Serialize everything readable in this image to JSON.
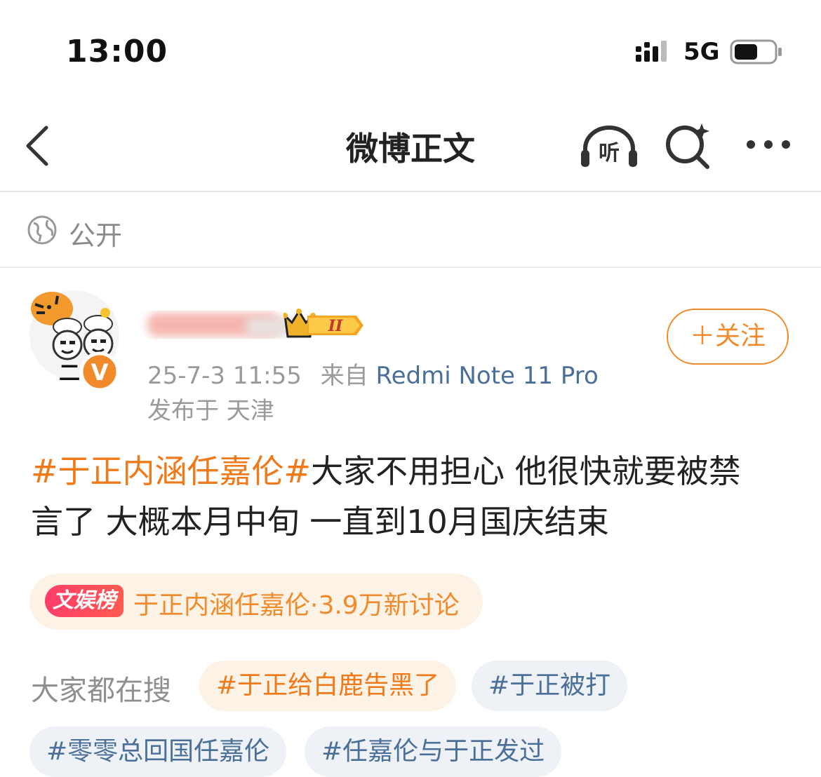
{
  "status_bar": {
    "time": "13:00",
    "network": "5G"
  },
  "nav": {
    "title": "微博正文",
    "listen_label": "听"
  },
  "visibility": {
    "label": "公开"
  },
  "author": {
    "follow_label": "＋关注",
    "verified_mark": "V",
    "avatar_text": "二"
  },
  "meta": {
    "time": "25-7-3 11:55",
    "from_label": "来自",
    "device": "Redmi Note 11 Pro",
    "location": "发布于 天津"
  },
  "post": {
    "hashtag": "#于正内涵任嘉伦#",
    "line1": "大家不用担心 他很快就要被禁",
    "line2": "言了  大概本月中旬  一直到10月国庆结束"
  },
  "trending": {
    "badge": "文娱榜",
    "text": "于正内涵任嘉伦·3.9万新讨论"
  },
  "searches": {
    "label": "大家都在搜",
    "chips": [
      "#于正给白鹿告黑了",
      "#于正被打",
      "#零零总回国任嘉伦",
      "#任嘉伦与于正发过"
    ]
  },
  "colors": {
    "accent_orange": "#f07a1a",
    "link_blue": "#4a6f98",
    "badge_red": "#ff3d6a"
  }
}
